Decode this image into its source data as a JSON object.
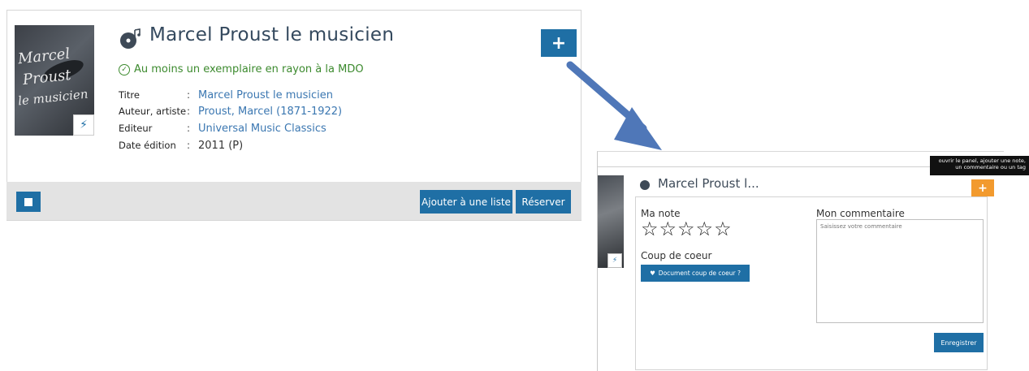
{
  "record": {
    "title": "Marcel Proust le musicien",
    "availability": "Au moins un exemplaire en rayon à la MDO",
    "cover_text": [
      "Marcel",
      "Proust",
      "le musicien"
    ],
    "meta": [
      {
        "label": "Titre",
        "sep": ":",
        "value": "Marcel Proust le musicien",
        "link": true
      },
      {
        "label": "Auteur, artiste",
        "sep": ":",
        "value": "Proust, Marcel (1871-1922)",
        "link": true
      },
      {
        "label": "Editeur",
        "sep": ":",
        "value": "Universal Music Classics",
        "link": true
      },
      {
        "label": "Date édition",
        "sep": ":",
        "value": "2011 (P)",
        "link": false
      }
    ],
    "plus_label": "+",
    "cover_badge_icon": "lightning-icon"
  },
  "actions": {
    "add_to_list": "Ajouter à une liste",
    "reserve": "Réserver"
  },
  "panel": {
    "title": "Marcel Proust l...",
    "tooltip_line1": "ouvrir le panel, ajouter une note,",
    "tooltip_line2": "un commentaire ou un tag",
    "plus_label": "+",
    "rating_label": "Ma note",
    "stars": "☆☆☆☆☆",
    "favorite_label": "Coup de coeur",
    "favorite_button": "Document coup de coeur ?",
    "comment_label": "Mon commentaire",
    "comment_placeholder": "Saisissez votre commentaire",
    "save_button": "Enregistrer"
  },
  "colors": {
    "primary_blue": "#1f6fa5",
    "available_green": "#3c8a2e",
    "link_blue": "#3b77b1",
    "orange": "#f29a2e",
    "arrow_blue": "#4f77b8"
  }
}
